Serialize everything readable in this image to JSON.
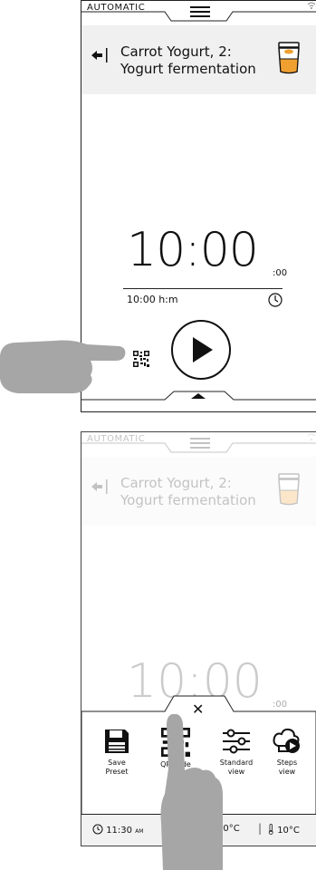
{
  "top_screen": {
    "mode": "AUTOMATIC",
    "recipe_title_line1": "Carrot Yogurt, 2:",
    "recipe_title_line2": "Yogurt fermentation",
    "timer_main": "10:00",
    "timer_seconds": ":00",
    "timer_unit": "10:00 h:m"
  },
  "bottom_screen": {
    "mode": "AUTOMATIC",
    "recipe_title_line1": "Carrot Yogurt, 2:",
    "recipe_title_line2": "Yogurt fermentation",
    "timer_main": "10:00",
    "timer_seconds": ":00",
    "close_label": "✕",
    "tools": [
      {
        "label_line1": "Save",
        "label_line2": "Preset",
        "icon": "save-icon"
      },
      {
        "label_line1": "QR code",
        "label_line2": "",
        "icon": "qr-code-icon"
      },
      {
        "label_line1": "Standard",
        "label_line2": "view",
        "icon": "sliders-icon"
      },
      {
        "label_line1": "Steps",
        "label_line2": "view",
        "icon": "steps-icon"
      }
    ],
    "status": {
      "time": "11:30",
      "ampm": "AM",
      "temp1": "10°C",
      "temp2": "10°C"
    }
  },
  "colors": {
    "header_bg": "#f0f0f0",
    "hand": "#a6a6a6",
    "yogurt_orange": "#f0a030"
  }
}
